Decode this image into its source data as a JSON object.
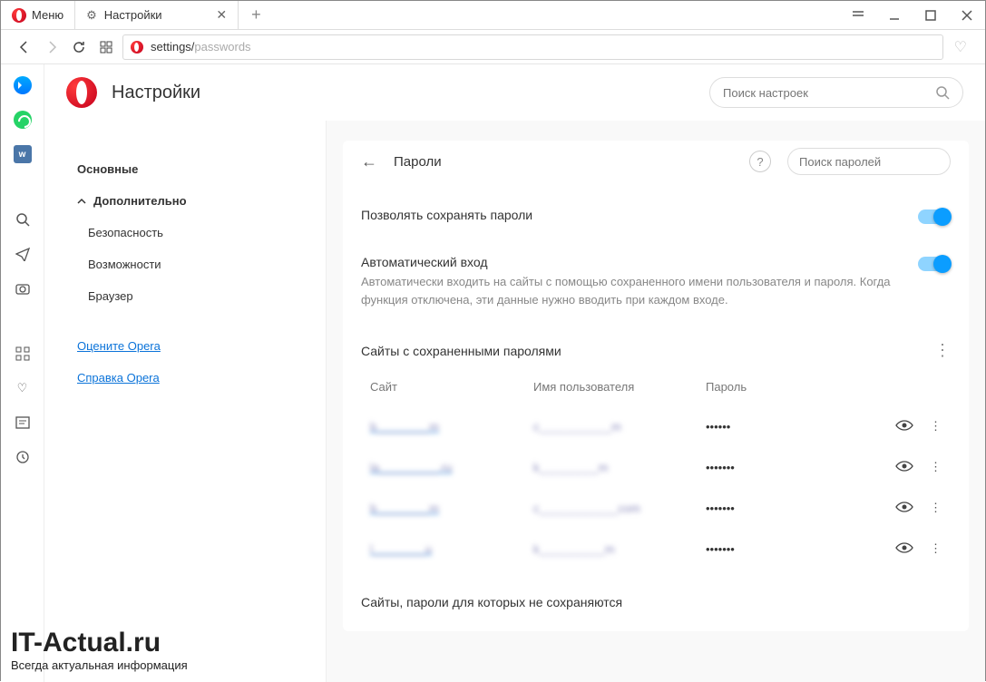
{
  "titlebar": {
    "menu_label": "Меню",
    "tab_title": "Настройки"
  },
  "address": {
    "url_prefix": "settings/",
    "url_suffix": "passwords"
  },
  "header": {
    "page_title": "Настройки",
    "search_placeholder": "Поиск настроек"
  },
  "sidenav": {
    "basic": "Основные",
    "advanced": "Дополнительно",
    "security": "Безопасность",
    "features": "Возможности",
    "browser": "Браузер",
    "rate": "Оцените Opera",
    "help": "Справка Opera"
  },
  "panel": {
    "title": "Пароли",
    "search_placeholder": "Поиск паролей",
    "save_passwords": "Позволять сохранять пароли",
    "auto_login_title": "Автоматический вход",
    "auto_login_desc": "Автоматически входить на сайты с помощью сохраненного имени пользователя и пароля. Когда функция отключена, эти данные нужно вводить при каждом входе.",
    "saved_section": "Сайты с сохраненными паролями",
    "col_site": "Сайт",
    "col_user": "Имя пользователя",
    "col_pass": "Пароль",
    "never_section": "Сайты, пароли для которых не сохраняются"
  },
  "rows": [
    {
      "site": "b________m",
      "user": "c___________m",
      "pass": "••••••"
    },
    {
      "site": "la_________.ru",
      "user": "k_________m",
      "pass": "•••••••"
    },
    {
      "site": "b________m",
      "user": "c____________com",
      "pass": "•••••••"
    },
    {
      "site": "l________u",
      "user": "k__________m",
      "pass": "•••••••"
    }
  ],
  "watermark": {
    "big": "IT-Actual.ru",
    "small": "Всегда актуальная информация"
  }
}
